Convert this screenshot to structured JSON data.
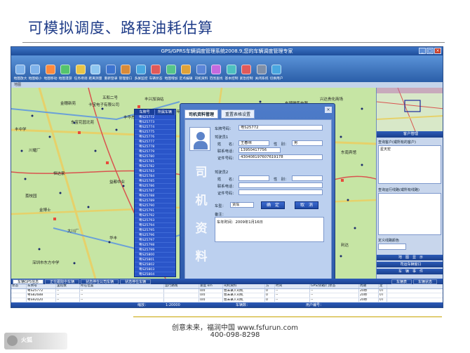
{
  "slide": {
    "title": "可模拟调度、路程油耗估算"
  },
  "app": {
    "window_title": "GPS/GPRS车辆调度管理系统2008.9,您的车辆调度管理专家",
    "window_buttons": [
      "_",
      "□",
      "×"
    ],
    "toolbar": [
      "地图放大",
      "地图缩小",
      "地图移动",
      "地图漫游",
      "任务待调",
      "距离测量",
      "重新登录",
      "管理窗口",
      "多屏监控",
      "车辆状态",
      "地图增加",
      "定点编辑",
      "司机资料",
      "范围查找",
      "基本控制",
      "紧急控制",
      "关闭系统",
      "切换用户"
    ],
    "subbar_label": "地图"
  },
  "map": {
    "labels": [
      "金穗新苑",
      "东宝花园北苑",
      "五和二号",
      "丰中学",
      "卡宝电子有限公司",
      "丰兴加油站",
      "建宝电源",
      "百年纺织",
      "丰华杰",
      "国际轧",
      "福兴城",
      "东博雅集电器",
      "兴达贵化商场",
      "东学校",
      "深圳市大鹏小学",
      "川耀厂",
      "同泰加油站",
      "丰达诚",
      "瑞达贸易大厦",
      "嘉达精密",
      "东南宾馆",
      "高锋科技",
      "恒达家",
      "益都中业",
      "深盛酒店",
      "众兴汽车",
      "金宝城",
      "方达成酒店",
      "利达",
      "东冠学校",
      "荔枝园",
      "金博士",
      "大川厂",
      "华丰",
      "深圳市东方中学",
      "宝华科技",
      "中兴花园"
    ]
  },
  "vehicle_list": {
    "headers": [
      "车牌号",
      "所属车辆"
    ],
    "rows": [
      "粤S25772",
      "粤S25773",
      "粤S25774",
      "粤S25775",
      "粤S25776",
      "粤S25777",
      "粤S25778",
      "粤S25779",
      "粤S25780",
      "粤S25781",
      "粤S25782",
      "粤S25783",
      "粤S25784",
      "粤S25785",
      "粤S25786",
      "粤S25787",
      "粤S25788",
      "粤S25789",
      "粤S25790",
      "粤S25791",
      "粤S25792",
      "粤S25793",
      "粤S25794",
      "粤S25795",
      "粤S25796",
      "粤S25797",
      "粤S25798",
      "粤S25799",
      "粤S25800",
      "粤S25801",
      "粤S25802",
      "粤S25803",
      "粤S25804"
    ]
  },
  "dialog": {
    "tabs": [
      "司机资料管理",
      "重置表格设置"
    ],
    "close": "×",
    "plate_label": "车牌号码：",
    "plate_value": "粤S25772",
    "driver1_label": "驾驶员1",
    "name_label": "姓　　名：",
    "name_value": "王春林",
    "gender_label": "性　别：",
    "gender_value": "男",
    "phone_label": "联系电话：",
    "phone_value": "13950417756",
    "id_label": "证件号码：",
    "id_value": "430408197607619178",
    "driver2_label": "驾驶员2",
    "name2_label": "姓　　名：",
    "gender2_label": "性　别：",
    "phone2_label": "联系电话：",
    "id2_label": "证件号码：",
    "vehicle_type_label": "车型：",
    "vehicle_type_value": "货车",
    "ok": "确　定",
    "cancel": "取　消",
    "note_label": "备注：",
    "note_value": "车年时间：2009年1月16日",
    "side_chars": [
      "司",
      "机",
      "资",
      "料"
    ]
  },
  "right_panel": {
    "header": "客户管理",
    "customer_label": "查询客户(或所有的客户)",
    "customer_value": "星天宏",
    "route_label": "查询运行线路(或所有线路)",
    "map_tool_label": "定义线路颜色",
    "tabs": [
      "地　图　显　示",
      "司运车辆窗口",
      "车　辆　事　件"
    ]
  },
  "bottom_grid": {
    "tabs": [
      "车辆GPS信息",
      "正在跟踪中车辆",
      "状态停在公司车辆",
      "状态停在车辆"
    ],
    "right_tabs": [
      "车辆表",
      "车辆状态"
    ],
    "headers": [
      "状态",
      "车牌号",
      "里程数",
      "所在位置",
      "运行路线",
      "速度 km",
      "司机资料",
      "方",
      "时间",
      "GPS/货箱/门状态",
      "周期",
      "定"
    ],
    "rows": [
      [
        "",
        "粤S25772",
        "--",
        "--",
        "",
        "0/0",
        "暂未录入司机",
        "0",
        "--",
        "--",
        "20秒",
        "0T"
      ],
      [
        "",
        "粤S82688",
        "--",
        "--",
        "",
        "0/0",
        "暂未录入司机",
        "0",
        "--",
        "--",
        "20秒",
        "0T"
      ],
      [
        "",
        "粤S92020",
        "--",
        "--",
        "",
        "0/0",
        "暂未录入司机",
        "0",
        "--",
        "--",
        "20秒",
        "0T"
      ],
      [
        "",
        "粤S82732",
        "--",
        "--",
        "",
        "0/0",
        "暂未录入司机",
        "0",
        "--",
        "--",
        "20秒",
        "0T"
      ],
      [
        "",
        "粤S21730",
        "--",
        "--",
        "",
        "0/0",
        "暂未录入司机",
        "0",
        "--",
        "--",
        "20秒",
        "0T"
      ]
    ]
  },
  "statusbar": {
    "zoom": "缩放：",
    "zoom_value": "1:20000",
    "count": "车辆数：",
    "user": "用户编号："
  },
  "footer": {
    "line1": "创意未来，福润中国 www.fsfurun.com",
    "line2": "400-098-8298",
    "logo_text": "火狐"
  }
}
